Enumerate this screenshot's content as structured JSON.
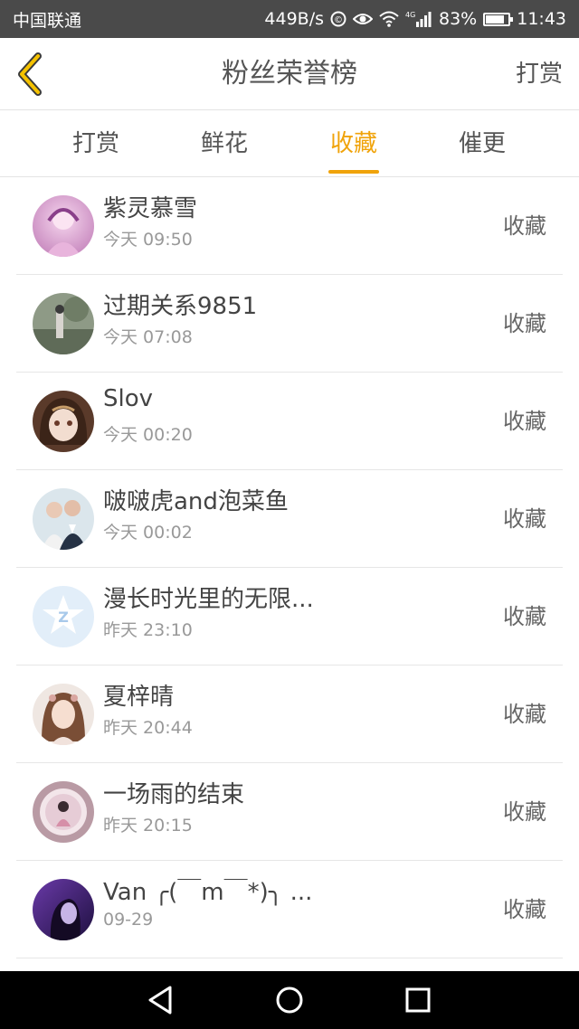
{
  "status_bar": {
    "carrier": "中国联通",
    "net_speed": "449B/s",
    "network_tag": "4G",
    "battery": "83%",
    "battery_level": 0.83,
    "time": "11:43"
  },
  "header": {
    "title": "粉丝荣誉榜",
    "action_label": "打赏"
  },
  "tabs": [
    {
      "label": "打赏",
      "active": false
    },
    {
      "label": "鲜花",
      "active": false
    },
    {
      "label": "收藏",
      "active": true
    },
    {
      "label": "催更",
      "active": false
    }
  ],
  "fans": [
    {
      "name": "紫灵慕雪",
      "time": "今天 09:50",
      "action": "收藏"
    },
    {
      "name": "过期关系9851",
      "time": "今天 07:08",
      "action": "收藏"
    },
    {
      "name": "Slov",
      "time": "今天 00:20",
      "action": "收藏"
    },
    {
      "name": "啵啵虎and泡菜鱼",
      "time": "今天 00:02",
      "action": "收藏"
    },
    {
      "name": "漫长时光里的无限...",
      "time": "昨天 23:10",
      "action": "收藏"
    },
    {
      "name": "夏梓晴",
      "time": "昨天 20:44",
      "action": "收藏"
    },
    {
      "name": "一场雨的结束",
      "time": "昨天 20:15",
      "action": "收藏"
    },
    {
      "name": "Van ╭(￣m￣*)╮ ...",
      "time": "09-29",
      "action": "收藏"
    }
  ],
  "colors": {
    "accent": "#f0a30a",
    "status_bar": "#4a4a4a",
    "nav_bar": "#000000"
  }
}
